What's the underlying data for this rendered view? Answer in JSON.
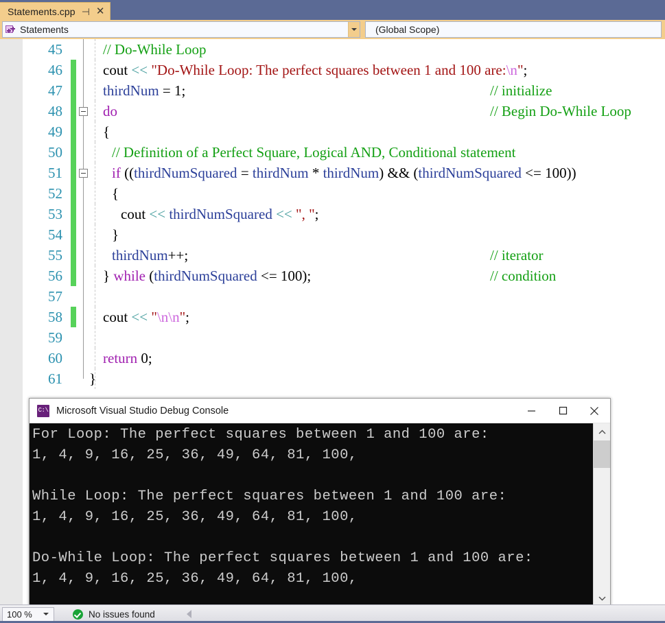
{
  "window": {
    "chrome_color": "#5b6a95"
  },
  "tab": {
    "label": "Statements.cpp",
    "pin_icon": "pin-icon",
    "close_icon": "close-icon"
  },
  "navbar": {
    "left_combo": {
      "icon": "cpp-project-icon",
      "value": "Statements"
    },
    "right_combo": {
      "value": "(Global Scope)"
    }
  },
  "editor": {
    "lines": [
      {
        "n": "45",
        "changed": false,
        "collapse": false,
        "indent": 0,
        "tokens": [
          {
            "t": "// Do-While Loop",
            "c": "cmt"
          }
        ],
        "trailing": null
      },
      {
        "n": "46",
        "changed": true,
        "collapse": false,
        "indent": 0,
        "tokens": [
          {
            "t": "cout ",
            "c": "blk"
          },
          {
            "t": "<<",
            "c": "op"
          },
          {
            "t": " ",
            "c": "blk"
          },
          {
            "t": "\"Do-While Loop: The perfect squares between 1 and 100 are:",
            "c": "str"
          },
          {
            "t": "\\n",
            "c": "esc"
          },
          {
            "t": "\"",
            "c": "str"
          },
          {
            "t": ";",
            "c": "blk"
          }
        ],
        "trailing": null
      },
      {
        "n": "47",
        "changed": true,
        "collapse": false,
        "indent": 0,
        "tokens": [
          {
            "t": "thirdNum",
            "c": "id"
          },
          {
            "t": " = 1;",
            "c": "blk"
          }
        ],
        "trailing": "// initialize"
      },
      {
        "n": "48",
        "changed": true,
        "collapse": true,
        "indent": 0,
        "tokens": [
          {
            "t": "do",
            "c": "kw"
          }
        ],
        "trailing": "// Begin Do-While Loop"
      },
      {
        "n": "49",
        "changed": true,
        "collapse": false,
        "indent": 0,
        "tokens": [
          {
            "t": "{",
            "c": "blk"
          }
        ],
        "trailing": null
      },
      {
        "n": "50",
        "changed": true,
        "collapse": false,
        "indent": 1,
        "tokens": [
          {
            "t": "// Definition of a Perfect Square, Logical AND, Conditional statement",
            "c": "cmt"
          }
        ],
        "trailing": null
      },
      {
        "n": "51",
        "changed": true,
        "collapse": true,
        "indent": 1,
        "tokens": [
          {
            "t": "if",
            "c": "kw"
          },
          {
            "t": " ((",
            "c": "blk"
          },
          {
            "t": "thirdNumSquared",
            "c": "id"
          },
          {
            "t": " = ",
            "c": "blk"
          },
          {
            "t": "thirdNum",
            "c": "id"
          },
          {
            "t": " * ",
            "c": "blk"
          },
          {
            "t": "thirdNum",
            "c": "id"
          },
          {
            "t": ") && (",
            "c": "blk"
          },
          {
            "t": "thirdNumSquared",
            "c": "id"
          },
          {
            "t": " <= 100))",
            "c": "blk"
          }
        ],
        "trailing": null
      },
      {
        "n": "52",
        "changed": true,
        "collapse": false,
        "indent": 1,
        "tokens": [
          {
            "t": "{",
            "c": "blk"
          }
        ],
        "trailing": null
      },
      {
        "n": "53",
        "changed": true,
        "collapse": false,
        "indent": 2,
        "tokens": [
          {
            "t": "cout ",
            "c": "blk"
          },
          {
            "t": "<<",
            "c": "op"
          },
          {
            "t": " ",
            "c": "blk"
          },
          {
            "t": "thirdNumSquared",
            "c": "id"
          },
          {
            "t": " ",
            "c": "blk"
          },
          {
            "t": "<<",
            "c": "op"
          },
          {
            "t": " ",
            "c": "blk"
          },
          {
            "t": "\", \"",
            "c": "str"
          },
          {
            "t": ";",
            "c": "blk"
          }
        ],
        "trailing": null
      },
      {
        "n": "54",
        "changed": true,
        "collapse": false,
        "indent": 1,
        "tokens": [
          {
            "t": "}",
            "c": "blk"
          }
        ],
        "trailing": null
      },
      {
        "n": "55",
        "changed": true,
        "collapse": false,
        "indent": 1,
        "tokens": [
          {
            "t": "thirdNum",
            "c": "id"
          },
          {
            "t": "++;",
            "c": "blk"
          }
        ],
        "trailing": "// iterator"
      },
      {
        "n": "56",
        "changed": true,
        "collapse": false,
        "indent": 0,
        "tokens": [
          {
            "t": "} ",
            "c": "blk"
          },
          {
            "t": "while",
            "c": "kw"
          },
          {
            "t": " (",
            "c": "blk"
          },
          {
            "t": "thirdNumSquared",
            "c": "id"
          },
          {
            "t": " <= 100);",
            "c": "blk"
          }
        ],
        "trailing": "// condition"
      },
      {
        "n": "57",
        "changed": false,
        "collapse": false,
        "indent": 0,
        "tokens": [],
        "trailing": null
      },
      {
        "n": "58",
        "changed": true,
        "collapse": false,
        "indent": 0,
        "tokens": [
          {
            "t": "cout ",
            "c": "blk"
          },
          {
            "t": "<<",
            "c": "op"
          },
          {
            "t": " ",
            "c": "blk"
          },
          {
            "t": "\"",
            "c": "str"
          },
          {
            "t": "\\n\\n",
            "c": "esc"
          },
          {
            "t": "\"",
            "c": "str"
          },
          {
            "t": ";",
            "c": "blk"
          }
        ],
        "trailing": null
      },
      {
        "n": "59",
        "changed": false,
        "collapse": false,
        "indent": 0,
        "tokens": [],
        "trailing": null
      },
      {
        "n": "60",
        "changed": false,
        "collapse": false,
        "indent": 0,
        "tokens": [
          {
            "t": "return",
            "c": "kw"
          },
          {
            "t": " 0;",
            "c": "blk"
          }
        ],
        "trailing": null
      },
      {
        "n": "61",
        "changed": false,
        "collapse": false,
        "indent": -1,
        "tokens": [
          {
            "t": "}",
            "c": "blk"
          }
        ],
        "trailing": null
      }
    ]
  },
  "console": {
    "title": "Microsoft Visual Studio Debug Console",
    "icon": "console-app-icon",
    "minimize_icon": "minimize-icon",
    "maximize_icon": "maximize-icon",
    "close_icon": "close-icon",
    "output": "For Loop: The perfect squares between 1 and 100 are:\n1, 4, 9, 16, 25, 36, 49, 64, 81, 100,\n\nWhile Loop: The perfect squares between 1 and 100 are:\n1, 4, 9, 16, 25, 36, 49, 64, 81, 100,\n\nDo-While Loop: The perfect squares between 1 and 100 are:\n1, 4, 9, 16, 25, 36, 49, 64, 81, 100,",
    "scroll_up_icon": "chevron-up-icon",
    "scroll_down_icon": "chevron-down-icon"
  },
  "statusbar": {
    "zoom": "100 %",
    "issues_icon": "check-circle-icon",
    "issues_text": "No issues found",
    "nav_back_icon": "triangle-left-icon"
  },
  "colors": {
    "accent_tab": "#f3cd8c",
    "chrome": "#5b6a95",
    "changebar": "#57d25a",
    "linenumber": "#2b91af",
    "comment": "#14a014",
    "keyword": "#a020b0",
    "string": "#a31515",
    "identifier": "#2b3f99",
    "operator": "#3f9a9a",
    "escape": "#cc66dd",
    "console_bg": "#0c0c0c",
    "console_fg": "#cccccc",
    "ok_green": "#19a337"
  }
}
